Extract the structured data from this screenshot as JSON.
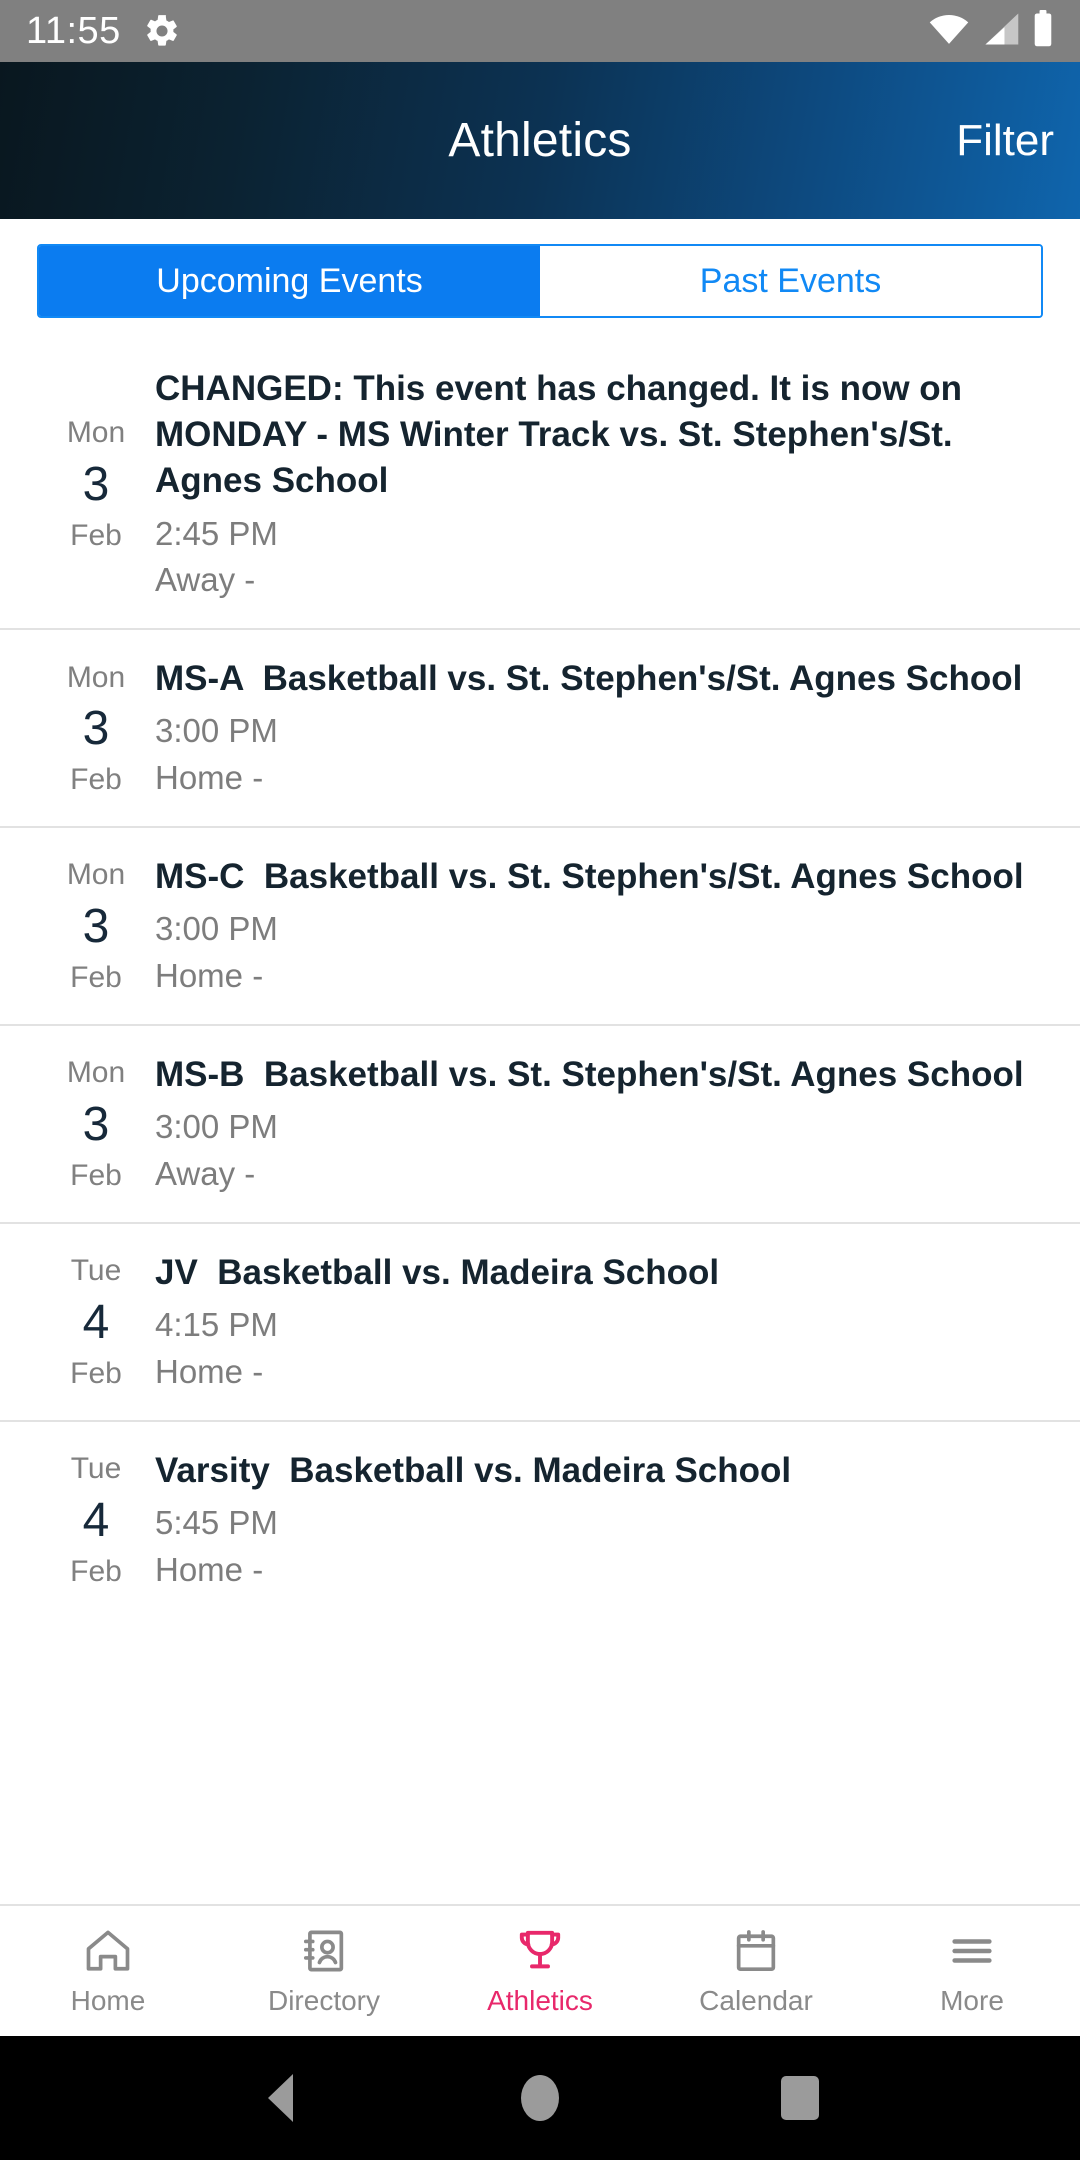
{
  "status_bar": {
    "time": "11:55",
    "gear_icon": "gear-icon",
    "wifi_icon": "wifi-icon",
    "cell_icon": "cellular-signal-icon",
    "battery_icon": "battery-full-icon",
    "background": "#808080"
  },
  "header": {
    "title": "Athletics",
    "action_label": "Filter",
    "gradient_from": "#09171f",
    "gradient_to": "#0f65ad"
  },
  "tabs": {
    "items": [
      {
        "label": "Upcoming Events",
        "active": true
      },
      {
        "label": "Past Events",
        "active": false
      }
    ],
    "accent": "#0b7cf0"
  },
  "events": [
    {
      "dow": "Mon",
      "day": "3",
      "month": "Feb",
      "title": "CHANGED: This event has changed. It is now on MONDAY - MS Winter Track vs. St. Stephen's/St. Agnes School",
      "time": "2:45 PM",
      "location": "Away -"
    },
    {
      "dow": "Mon",
      "day": "3",
      "month": "Feb",
      "title": "MS-A  Basketball vs. St. Stephen's/St. Agnes School",
      "time": "3:00 PM",
      "location": "Home -"
    },
    {
      "dow": "Mon",
      "day": "3",
      "month": "Feb",
      "title": "MS-C  Basketball vs. St. Stephen's/St. Agnes School",
      "time": "3:00 PM",
      "location": "Home -"
    },
    {
      "dow": "Mon",
      "day": "3",
      "month": "Feb",
      "title": "MS-B  Basketball vs. St. Stephen's/St. Agnes School",
      "time": "3:00 PM",
      "location": "Away -"
    },
    {
      "dow": "Tue",
      "day": "4",
      "month": "Feb",
      "title": "JV  Basketball vs. Madeira School",
      "time": "4:15 PM",
      "location": "Home -"
    },
    {
      "dow": "Tue",
      "day": "4",
      "month": "Feb",
      "title": "Varsity  Basketball vs. Madeira School",
      "time": "5:45 PM",
      "location": "Home -"
    }
  ],
  "bottom_nav": {
    "active_color": "#e8286b",
    "inactive_color": "#8a8a8a",
    "items": [
      {
        "label": "Home",
        "icon": "home-icon",
        "active": false
      },
      {
        "label": "Directory",
        "icon": "directory-icon",
        "active": false
      },
      {
        "label": "Athletics",
        "icon": "trophy-icon",
        "active": true
      },
      {
        "label": "Calendar",
        "icon": "calendar-icon",
        "active": false
      },
      {
        "label": "More",
        "icon": "hamburger-menu-icon",
        "active": false
      }
    ]
  },
  "android_nav": {
    "back": "back-triangle-icon",
    "home": "home-circle-icon",
    "recents": "recents-square-icon"
  }
}
